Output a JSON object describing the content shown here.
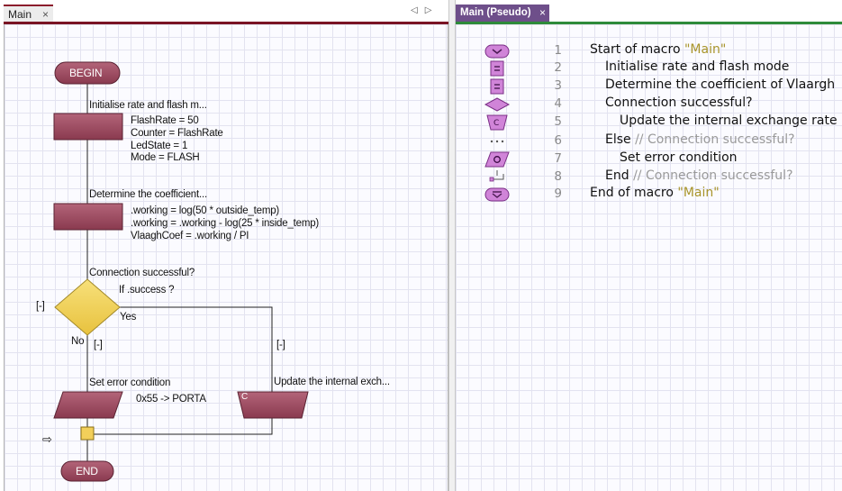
{
  "left_tab": {
    "label": "Main",
    "close": "×"
  },
  "right_tab": {
    "label": "Main (Pseudo)",
    "close": "×"
  },
  "colors": {
    "block_fill": "#9b4a5e",
    "terminal_fill": "#a04a5e",
    "decision_fill": "#f2d05a",
    "icon_fill": "#d084d8",
    "string_color": "#a8942a",
    "comment_color": "#9a9a9a"
  },
  "flowchart": {
    "begin": "BEGIN",
    "end": "END",
    "calc1": {
      "title": "Initialise rate and flash m...",
      "lines": [
        "FlashRate = 50",
        "Counter = FlashRate",
        "LedState = 1",
        "Mode = FLASH"
      ]
    },
    "calc2": {
      "title": "Determine the coefficient...",
      "lines": [
        ".working = log(50 * outside_temp)",
        ".working = .working - log(25 * inside_temp)",
        "VlaaghCoef = .working / PI"
      ]
    },
    "decision": {
      "title": "Connection successful?",
      "condition": "If .success ?",
      "yes": "Yes",
      "no": "No",
      "collapse": "[-]",
      "collapse_no": "[-]",
      "collapse_yes": "[-]"
    },
    "output": {
      "title": "Set error condition",
      "text": "0x55 -> PORTA"
    },
    "cmacro": {
      "title": "Update the internal exch...",
      "label": "C"
    },
    "arrow": "⇨"
  },
  "pseudo": [
    {
      "num": "1",
      "icon": "begin-icon",
      "indent": 0,
      "text": "Start of macro ",
      "str": "\"Main\"",
      "cmt": ""
    },
    {
      "num": "2",
      "icon": "calculation-icon",
      "indent": 1,
      "text": "Initialise rate and flash mode",
      "str": "",
      "cmt": ""
    },
    {
      "num": "3",
      "icon": "calculation-icon",
      "indent": 1,
      "text": "Determine the coefficient of Vlaargh",
      "str": "",
      "cmt": ""
    },
    {
      "num": "4",
      "icon": "decision-icon",
      "indent": 1,
      "text": "Connection successful?",
      "str": "",
      "cmt": ""
    },
    {
      "num": "5",
      "icon": "c-code-icon",
      "indent": 2,
      "text": "Update the internal exchange rate",
      "str": "",
      "cmt": ""
    },
    {
      "num": "6",
      "icon": "else-icon",
      "indent": 1,
      "text": "Else ",
      "str": "",
      "cmt": "// Connection successful?"
    },
    {
      "num": "7",
      "icon": "output-icon",
      "indent": 2,
      "text": "Set error condition",
      "str": "",
      "cmt": ""
    },
    {
      "num": "8",
      "icon": "end-if-icon",
      "indent": 1,
      "text": "End ",
      "str": "",
      "cmt": "// Connection successful?"
    },
    {
      "num": "9",
      "icon": "end-icon",
      "indent": 0,
      "text": "End of macro ",
      "str": "\"Main\"",
      "cmt": ""
    }
  ]
}
